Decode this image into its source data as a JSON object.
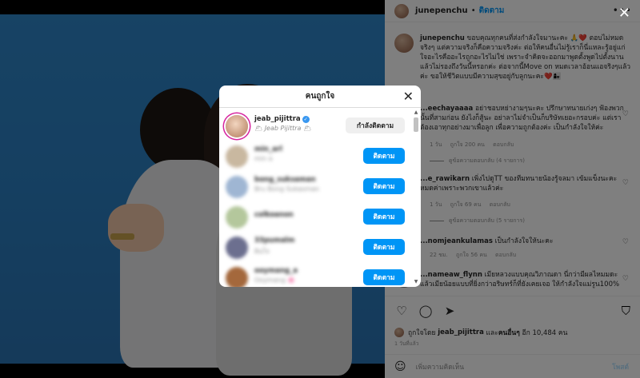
{
  "post": {
    "author": "junepenchu",
    "follow_label": "ติดตาม",
    "separator": "•",
    "more_icon": "more-horizontal-icon",
    "caption": "ขอบคุณทุกคนที่ส่งกำลังใจมานะคะ 🙏❤️ ตอบไม่หมดจริงๆ แต่ความจริงก็คือความจริงค่ะ ต่อให้คนอื่นไม่รู้เราก็นี่แหละรู้อยู่แก่ใจอะไรคืออะไรถูกอะไรไม่ใช่ เพราะจำคิดจะออกมาพูดตั้งพูดไปตั้งนานแล้วไม่รองถึงวันนี้หรอกค่ะ ต่อจากนี้Move on หมดเวลาอ้อนแอจริงๆแล้วค่ะ ขอให้ชีวิตแบบมีความสุขอยู่กับลูกนะคะ❤️👩‍👧"
  },
  "comments": [
    {
      "user": "...eechayaaaa",
      "text": "อย่าชอบหย่างามๆนะคะ ปรึกษาทนายเก่งๆ ฟ้องพวกนั้นที่สามก่อน ยังไงก็สู้นะ อย่าลาไม่จำเป็นก็บริษัทเยอะกรอบค่ะ แต่เราต้องเอาทุกอย่างมาเพื่อลูก เพื่อความถูกต้องค่ะ เป็นกำลังใจให้ค่ะ",
      "time": "1 วัน",
      "likes": "ถูกใจ 200 คน",
      "reply": "ตอบกลับ",
      "view_replies": "ดูข้อความตอบกลับ (4 รายการ)"
    },
    {
      "user": "...e_rawikarn",
      "text": "เพิ่งไปดูTT ของทีมทนายน้องรู้จลมา เข้มแข็งนะคะ หมดค่าเพราะพวกเขาแล้วค่ะ",
      "time": "1 วัน",
      "likes": "ถูกใจ 69 คน",
      "reply": "ตอบกลับ",
      "view_replies": "ดูข้อความตอบกลับ (5 รายการ)"
    },
    {
      "user": "...nomjeankulamas",
      "text": "เป็นกำลังใจให้นะคะ",
      "time": "22 ชม.",
      "likes": "ถูกใจ 56 คน",
      "reply": "ตอบกลับ"
    },
    {
      "user": "...nameaw_flynn",
      "text": "เมียหลวงแบบคุณวิภาณดา นี่กว่ามีผลไหมมดะ แล้วเมียน้อยแบบที่ยิ่งกว่าอริษทร์ก็ที่ยังเคยเจอ ให้กำลังใจแม่รูน100%",
      "time": "",
      "likes": "",
      "reply": ""
    }
  ],
  "actions": {
    "like_icon": "heart-icon",
    "comment_icon": "comment-icon",
    "share_icon": "send-icon",
    "save_icon": "bookmark-icon",
    "liked_by_prefix": "ถูกใจโดย",
    "liked_by_user": "jeab_pijittra",
    "liked_by_and": "และ",
    "liked_by_others": "คนอื่นๆ",
    "liked_by_count": "อีก 10,484 คน",
    "date": "1 วันที่แล้ว",
    "emoji_icon": "smile-icon",
    "comment_placeholder": "เพิ่มความคิดเห็น",
    "post_label": "โพสต์"
  },
  "modal": {
    "title": "คนถูกใจ",
    "close_icon": "close-icon",
    "users": [
      {
        "username": "jeab_pijittra",
        "subtitle": "🌥 Jeab Pijittra 🌥",
        "button": "กำลังติดตาม",
        "following": true,
        "verified": true,
        "blurred": false,
        "color": "#e8c9b0"
      },
      {
        "username": "min_arl",
        "subtitle": "min a",
        "button": "ติดตาม",
        "following": false,
        "verified": false,
        "blurred": true,
        "color": "#c9b8a0"
      },
      {
        "username": "bong_suksaman",
        "subtitle": "Bru Bong Sukasman",
        "button": "ติดตาม",
        "following": false,
        "verified": false,
        "blurred": true,
        "color": "#9fb6d3"
      },
      {
        "username": "colkoanon",
        "subtitle": "",
        "button": "ติดตาม",
        "following": false,
        "verified": false,
        "blurred": true,
        "color": "#b4c79c"
      },
      {
        "username": "33pumalm",
        "subtitle": "ฝันใจ",
        "button": "ติดตาม",
        "following": false,
        "verified": false,
        "blurred": true,
        "color": "#6c6f8f"
      },
      {
        "username": "ooymang_a",
        "subtitle": "Ooymang 🌸",
        "button": "ติดตาม",
        "following": false,
        "verified": false,
        "blurred": true,
        "color": "#a4683c"
      }
    ]
  },
  "overlay": {
    "close_icon": "close-icon"
  }
}
